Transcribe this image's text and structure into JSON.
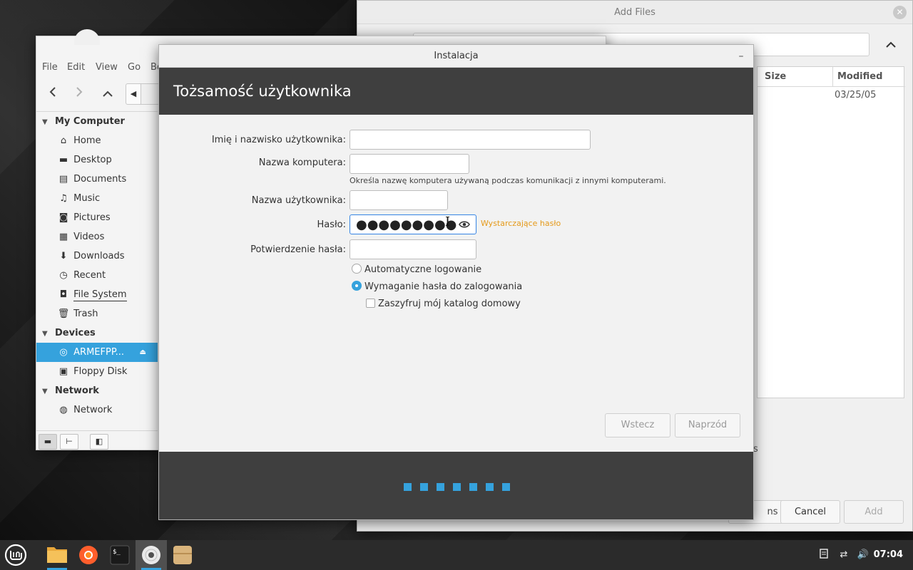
{
  "add_files": {
    "title": "Add Files",
    "columns": {
      "size": "Size",
      "modified": "Modified"
    },
    "rows": [
      {
        "modified": "03/25/05"
      }
    ],
    "stray_text": "s",
    "buttons": {
      "options": "ns",
      "cancel": "Cancel",
      "add": "Add"
    }
  },
  "file_manager": {
    "menu": [
      "File",
      "Edit",
      "View",
      "Go",
      "Bo"
    ],
    "sidebar": {
      "sections": [
        {
          "label": "My Computer"
        },
        {
          "label": "Devices"
        },
        {
          "label": "Network"
        }
      ],
      "my_computer": [
        "Home",
        "Desktop",
        "Documents",
        "Music",
        "Pictures",
        "Videos",
        "Downloads",
        "Recent",
        "File System",
        "Trash"
      ],
      "devices": [
        "ARMEFPP...",
        "Floppy Disk"
      ],
      "network": [
        "Network"
      ]
    }
  },
  "installer": {
    "title": "Instalacja",
    "header": "Tożsamość użytkownika",
    "fields": {
      "fullname_label": "Imię i nazwisko użytkownika:",
      "computer_label": "Nazwa komputera:",
      "computer_hint": "Określa nazwę komputera używaną podczas komunikacji z innymi komputerami.",
      "username_label": "Nazwa użytkownika:",
      "password_label": "Hasło:",
      "password_value": "●●●●●●●●●",
      "password_strength": "Wystarczające hasło",
      "confirm_label": "Potwierdzenie hasła:"
    },
    "options": {
      "auto_login": "Automatyczne logowanie",
      "require_password": "Wymaganie hasła do zalogowania",
      "encrypt_home": "Zaszyfruj mój katalog domowy"
    },
    "buttons": {
      "back": "Wstecz",
      "forward": "Naprzód"
    },
    "progress": {
      "steps": 7
    }
  },
  "taskbar": {
    "clock": "07:04",
    "launchers": [
      "mint-menu-icon",
      "files-icon",
      "firefox-icon",
      "terminal-icon",
      "disc-installer-icon",
      "archive-icon"
    ]
  },
  "colors": {
    "accent": "#35a2dd",
    "header": "#3f3f3f",
    "warning": "#e59a1a"
  }
}
